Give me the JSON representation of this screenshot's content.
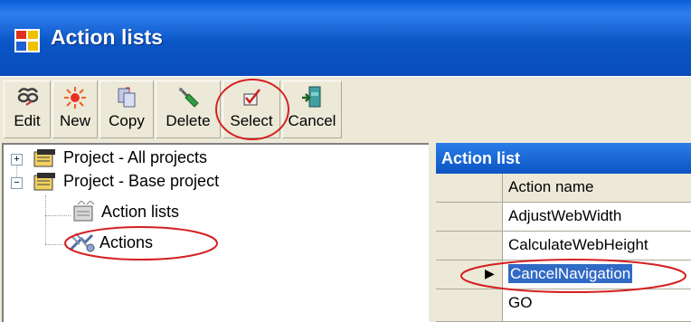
{
  "window": {
    "title": "Action lists"
  },
  "toolbar": {
    "buttons": [
      {
        "label": "Edit",
        "icon": "edit-icon"
      },
      {
        "label": "New",
        "icon": "new-icon"
      },
      {
        "label": "Copy",
        "icon": "copy-icon"
      },
      {
        "label": "Delete",
        "icon": "delete-icon"
      },
      {
        "label": "Select",
        "icon": "select-icon"
      },
      {
        "label": "Cancel",
        "icon": "cancel-icon"
      }
    ]
  },
  "tree": {
    "items": [
      {
        "label": "Project - All projects",
        "expander": "+"
      },
      {
        "label": "Project - Base project",
        "expander": "−"
      },
      {
        "label": "Action lists"
      },
      {
        "label": "Actions"
      }
    ]
  },
  "grid": {
    "caption": "Action list",
    "column_header": "Action name",
    "rows": [
      "AdjustWebWidth",
      "CalculateWebHeight",
      "CancelNavigation",
      "GO"
    ],
    "current_row_indicator": "▶"
  },
  "colors": {
    "titlebar": "#0b56c6",
    "selection": "#316ac5",
    "annotation": "#d42020"
  }
}
